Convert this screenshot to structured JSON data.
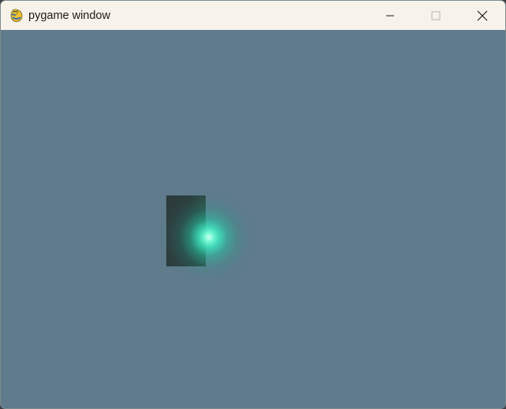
{
  "window": {
    "title": "pygame window",
    "app_icon": "pygame-snake-icon",
    "controls": {
      "minimize_icon": "minimize-icon",
      "maximize_icon": "maximize-icon",
      "close_icon": "close-icon"
    }
  },
  "game": {
    "background_color": "#5f7b8c",
    "rect_color": "#2d3b3c",
    "glow_color": "#3ce6be"
  }
}
